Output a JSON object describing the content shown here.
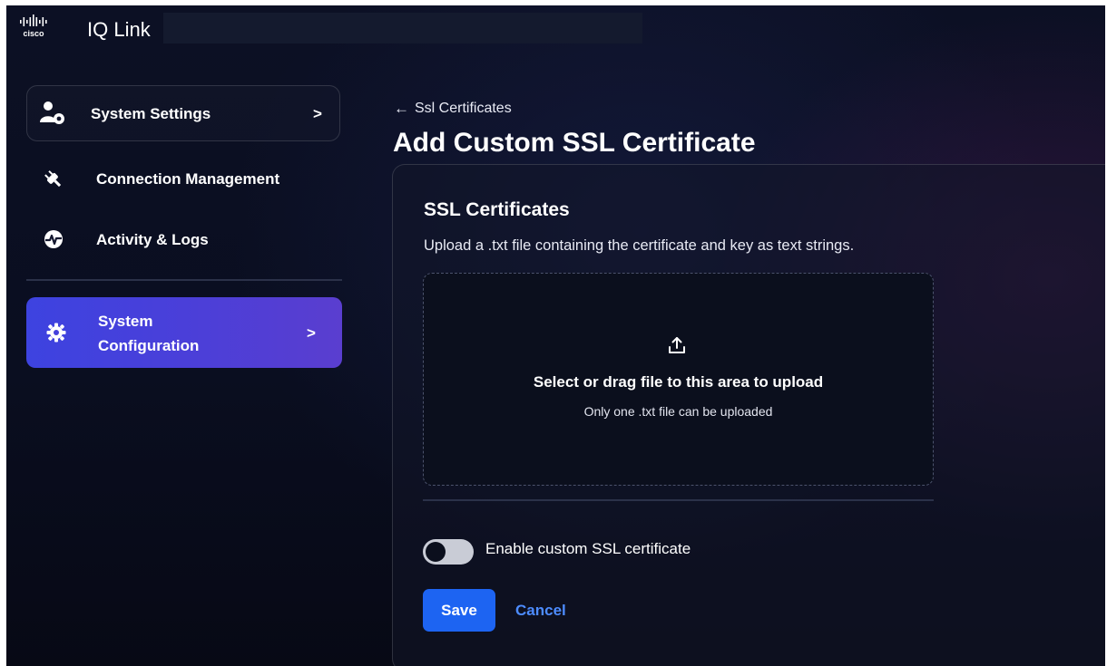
{
  "header": {
    "brand": "cisco",
    "app_title": "IQ Link"
  },
  "sidebar": {
    "items": [
      {
        "label": "System Settings",
        "icon": "user-gear-icon",
        "chevron": ">"
      },
      {
        "label": "Connection Management",
        "icon": "plug-icon"
      },
      {
        "label": "Activity & Logs",
        "icon": "activity-pulse-icon"
      },
      {
        "label_line1": "System",
        "label_line2": "Configuration",
        "icon": "gear-icon",
        "chevron": ">",
        "active": true
      }
    ]
  },
  "breadcrumb": {
    "arrow": "←",
    "label": "Ssl Certificates"
  },
  "page": {
    "title": "Add Custom SSL Certificate"
  },
  "section": {
    "title": "SSL Certificates",
    "description": "Upload a .txt file containing the certificate and key as text strings."
  },
  "dropzone": {
    "icon": "upload-icon",
    "main_text": "Select or drag file to this area to upload",
    "sub_text": "Only one .txt file can be uploaded"
  },
  "toggle": {
    "label": "Enable custom SSL certificate",
    "enabled": false
  },
  "actions": {
    "save_label": "Save",
    "cancel_label": "Cancel"
  },
  "colors": {
    "accent_active": "#4a3fd9",
    "primary_button": "#1d64f2",
    "link": "#4d8cff",
    "background": "#0b0f20"
  }
}
